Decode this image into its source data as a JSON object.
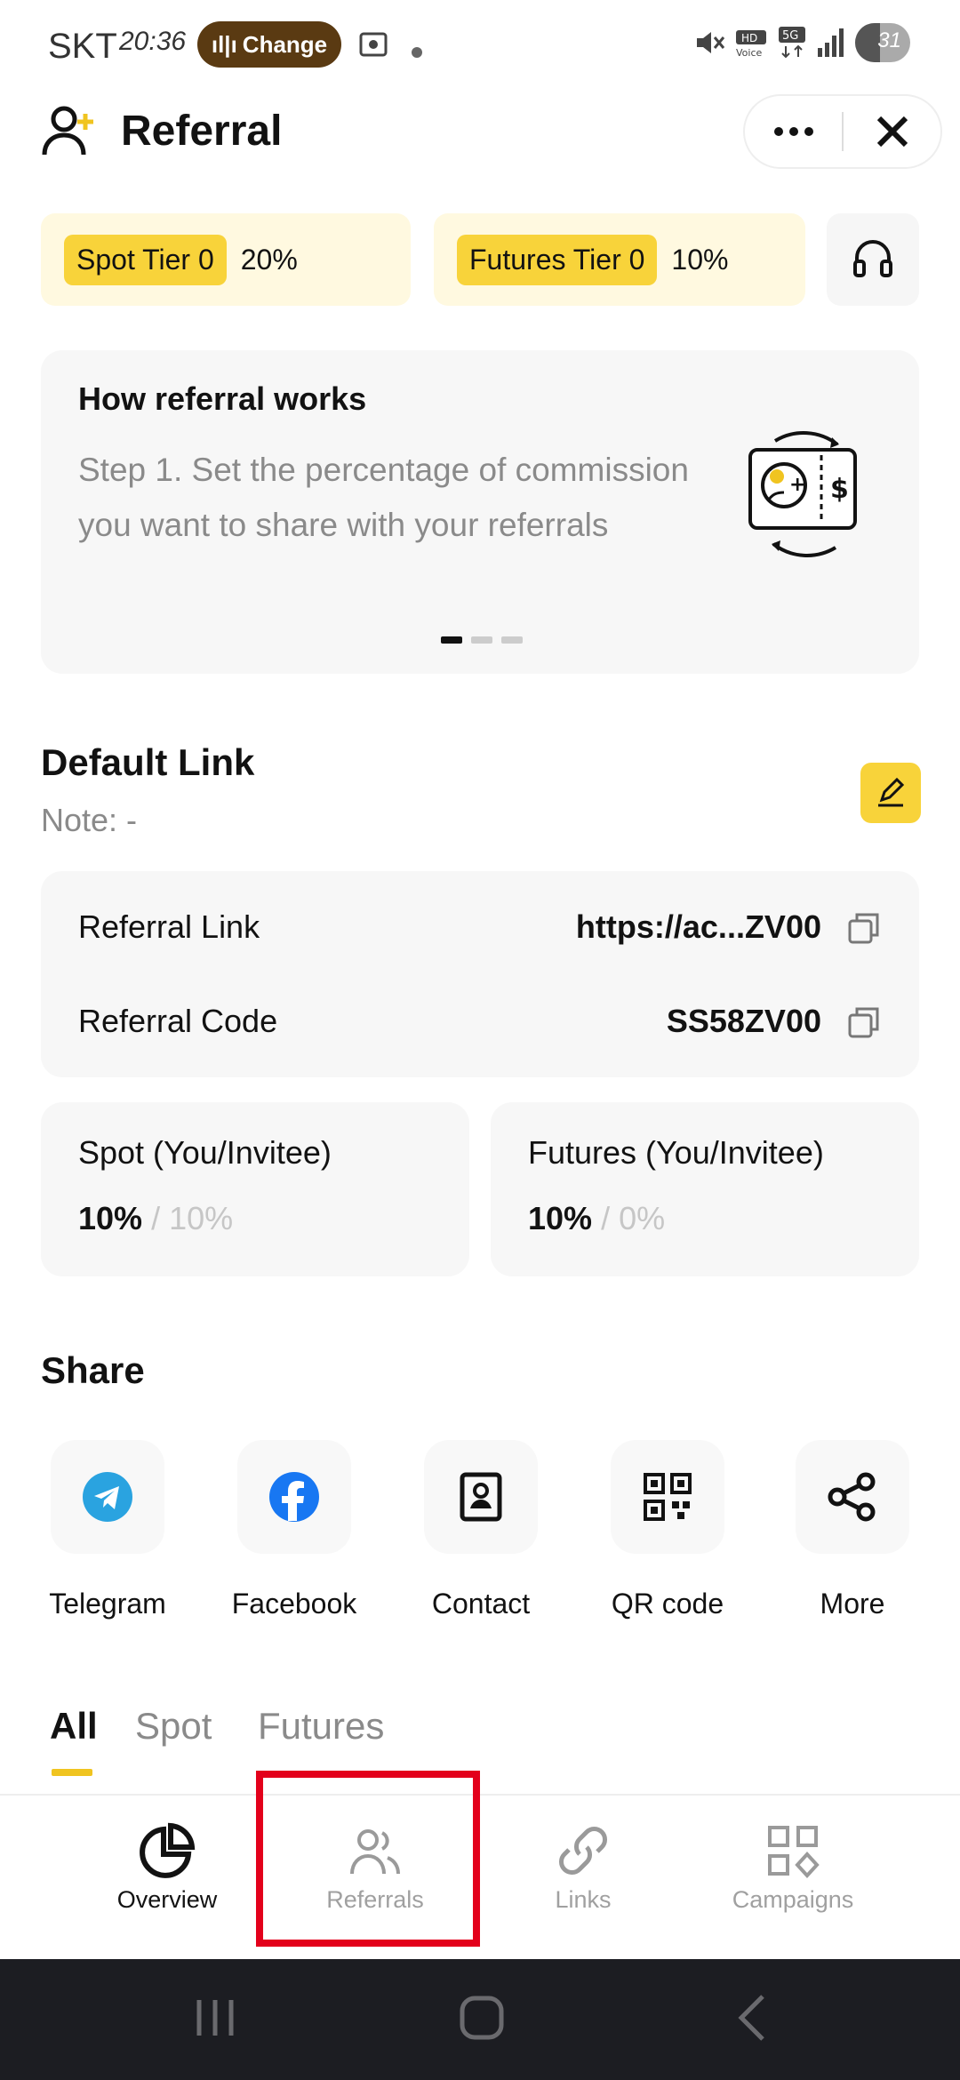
{
  "status_bar": {
    "carrier": "SKT",
    "time": "20:36",
    "pill_label": "Change",
    "battery": "31"
  },
  "header": {
    "title": "Referral"
  },
  "tiers": [
    {
      "label": "Spot Tier 0",
      "pct": "20%"
    },
    {
      "label": "Futures Tier 0",
      "pct": "10%"
    }
  ],
  "how": {
    "title": "How referral works",
    "text": "Step 1. Set the percentage of commission you want to share with your referrals",
    "page_count": 3,
    "active_page": 1
  },
  "default_link": {
    "title": "Default Link",
    "note": "Note: -",
    "rows": [
      {
        "label": "Referral Link",
        "value": "https://ac...ZV00"
      },
      {
        "label": "Referral Code",
        "value": "SS58ZV00"
      }
    ],
    "splits": [
      {
        "label": "Spot (You/Invitee)",
        "you": "10%",
        "invitee": "/ 10%"
      },
      {
        "label": "Futures (You/Invitee)",
        "you": "10%",
        "invitee": "/ 0%"
      }
    ]
  },
  "share": {
    "title": "Share",
    "items": [
      {
        "label": "Telegram",
        "icon": "telegram-icon"
      },
      {
        "label": "Facebook",
        "icon": "facebook-icon"
      },
      {
        "label": "Contact",
        "icon": "contact-icon"
      },
      {
        "label": "QR code",
        "icon": "qr-code-icon"
      },
      {
        "label": "More",
        "icon": "share-icon"
      }
    ]
  },
  "tabs": [
    {
      "label": "All",
      "active": true
    },
    {
      "label": "Spot",
      "active": false
    },
    {
      "label": "Futures",
      "active": false
    }
  ],
  "bottom_nav": [
    {
      "label": "Overview",
      "icon": "pie-chart-icon",
      "active": true
    },
    {
      "label": "Referrals",
      "icon": "users-icon",
      "active": false
    },
    {
      "label": "Links",
      "icon": "link-icon",
      "active": false
    },
    {
      "label": "Campaigns",
      "icon": "grid-icon",
      "active": false
    }
  ],
  "colors": {
    "accent_yellow": "#f8d33a",
    "tier_bg": "#fff9e0",
    "highlight_red": "#e3001b"
  }
}
